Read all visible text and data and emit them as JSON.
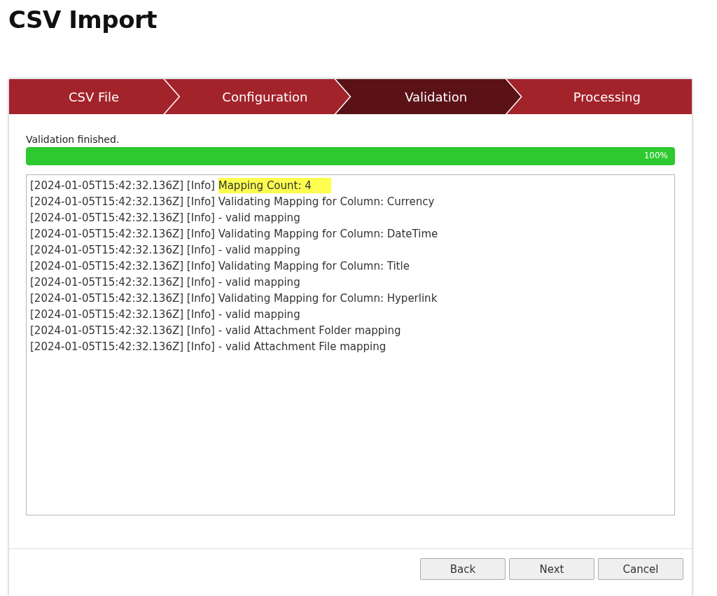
{
  "page_title": "CSV Import",
  "steps": [
    {
      "label": "CSV File",
      "selected": false
    },
    {
      "label": "Configuration",
      "selected": false
    },
    {
      "label": "Validation",
      "selected": true
    },
    {
      "label": "Processing",
      "selected": false
    }
  ],
  "status": "Validation finished.",
  "progress": {
    "level": 1,
    "reading": "100%"
  },
  "log": [
    {
      "prefix": "[2024-01-05T15:42:32.136Z] [Info]",
      "message": "Mapping Count: 4",
      "highlighted": true
    },
    {
      "prefix": "[2024-01-05T15:42:32.136Z] [Info]",
      "message": "Validating Mapping for Column: Currency",
      "highlighted": false
    },
    {
      "prefix": "[2024-01-05T15:42:32.136Z] [Info]",
      "message": "- valid mapping",
      "highlighted": false
    },
    {
      "prefix": "[2024-01-05T15:42:32.136Z] [Info]",
      "message": "Validating Mapping for Column: DateTime",
      "highlighted": false
    },
    {
      "prefix": "[2024-01-05T15:42:32.136Z] [Info]",
      "message": "- valid mapping",
      "highlighted": false
    },
    {
      "prefix": "[2024-01-05T15:42:32.136Z] [Info]",
      "message": "Validating Mapping for Column: Title",
      "highlighted": false
    },
    {
      "prefix": "[2024-01-05T15:42:32.136Z] [Info]",
      "message": "- valid mapping",
      "highlighted": false
    },
    {
      "prefix": "[2024-01-05T15:42:32.136Z] [Info]",
      "message": "Validating Mapping for Column: Hyperlink",
      "highlighted": false
    },
    {
      "prefix": "[2024-01-05T15:42:32.136Z] [Info]",
      "message": "- valid mapping",
      "highlighted": false
    },
    {
      "prefix": "[2024-01-05T15:42:32.136Z] [Info]",
      "message": "- valid Attachment Folder mapping",
      "highlighted": false
    },
    {
      "prefix": "[2024-01-05T15:42:32.136Z] [Info]",
      "message": "- valid Attachment File mapping",
      "highlighted": false
    }
  ],
  "buttons": [
    "Back",
    "Next",
    "Cancel"
  ]
}
